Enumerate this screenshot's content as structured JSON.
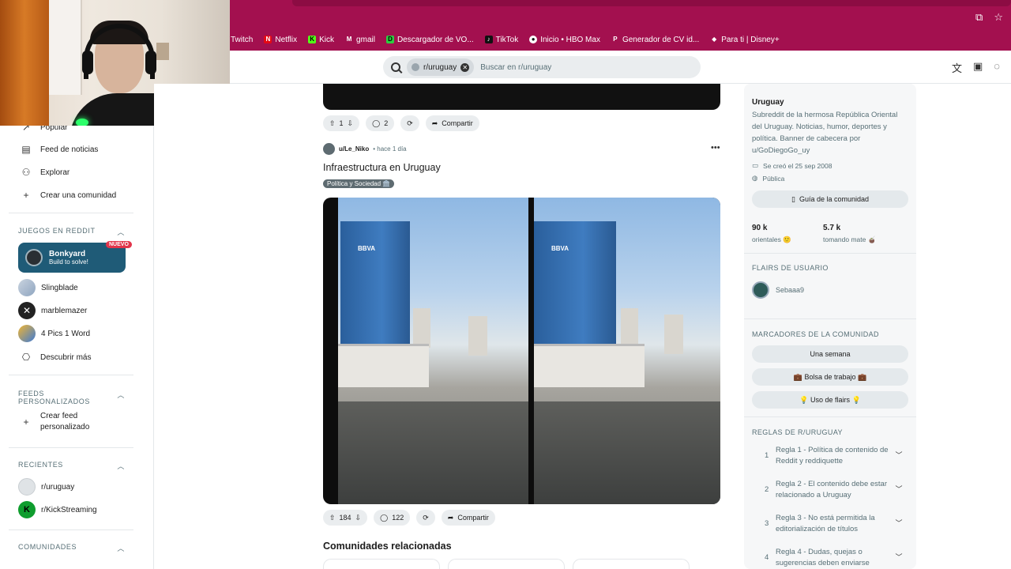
{
  "browser": {
    "bookmarks": [
      {
        "label": "Twitch",
        "icon": "twitch-icon",
        "color": "#a970ff"
      },
      {
        "label": "Netflix",
        "icon": "netflix-icon",
        "color": "#e50914"
      },
      {
        "label": "Kick",
        "icon": "kick-icon",
        "color": "#53fc18"
      },
      {
        "label": "gmail",
        "icon": "gmail-icon",
        "color": "#ea4335"
      },
      {
        "label": "Descargador de VO...",
        "icon": "downloader-icon",
        "color": "#2ecc40"
      },
      {
        "label": "TikTok",
        "icon": "tiktok-icon",
        "color": "#111111"
      },
      {
        "label": "Inicio • HBO Max",
        "icon": "hbo-icon",
        "color": "#111111"
      },
      {
        "label": "Generador de CV id...",
        "icon": "cv-icon",
        "color": "#ffffff"
      },
      {
        "label": "Para ti | Disney+",
        "icon": "disney-icon",
        "color": "#113ccf"
      }
    ]
  },
  "header": {
    "search_chip": "r/uruguay",
    "search_placeholder": "Buscar en r/uruguay"
  },
  "sidebar": {
    "items": [
      {
        "label": "Popular",
        "icon": "trending-icon"
      },
      {
        "label": "Feed de noticias",
        "icon": "news-icon"
      },
      {
        "label": "Explorar",
        "icon": "explore-icon"
      },
      {
        "label": "Crear una comunidad",
        "icon": "plus-icon"
      }
    ],
    "games_heading": "JUEGOS EN REDDIT",
    "featured_game": {
      "name": "Bonkyard",
      "subtitle": "Build to solve!",
      "badge": "NUEVO"
    },
    "games": [
      "Slingblade",
      "marblemazer",
      "4 Pics 1 Word",
      "Descubrir más"
    ],
    "custom_feeds_heading": "FEEDS PERSONALIZADOS",
    "create_feed_line1": "Crear feed",
    "create_feed_line2": "personalizado",
    "recents_heading": "RECIENTES",
    "recents": [
      "r/uruguay",
      "r/KickStreaming"
    ],
    "communities_heading": "COMUNIDADES"
  },
  "feed": {
    "prev_post": {
      "votes": "1",
      "comments": "2",
      "share": "Compartir"
    },
    "post": {
      "author": "u/Le_Niko",
      "time": "• hace 1 día",
      "title": "Infraestructura en Uruguay",
      "flair": "Política y Sociedad 🏛️",
      "votes": "184",
      "comments": "122",
      "share": "Compartir",
      "image_label": "BBVA"
    },
    "related_title": "Comunidades relacionadas"
  },
  "community": {
    "name": "Uruguay",
    "description": "Subreddit de la hermosa República Oriental del Uruguay. Noticias, humor, deportes y política. Banner de cabecera por u/GoDiegoGo_uy",
    "created": "Se creó el 25 sep 2008",
    "visibility": "Pública",
    "guide_button": "Guía de la comunidad",
    "members_count": "90 k",
    "members_label": "orientales 🙂",
    "online_count": "5.7 k",
    "online_label": "tomando mate 🧉",
    "user_flairs_heading": "FLAIRS DE USUARIO",
    "user_flair": "Sebaaa9",
    "bookmarks_heading": "MARCADORES DE LA COMUNIDAD",
    "bookmarks": [
      "Una semana",
      "💼 Bolsa de trabajo 💼",
      "💡 Uso de flairs 💡"
    ],
    "rules_heading": "REGLAS DE R/URUGUAY",
    "rules": [
      {
        "num": "1",
        "text": "Regla 1 - Política de contenido de Reddit y reddiquette"
      },
      {
        "num": "2",
        "text": "Regla 2 - El contenido debe estar relacionado a Uruguay"
      },
      {
        "num": "3",
        "text": "Regla 3 - No está permitida la editorialización de títulos"
      },
      {
        "num": "4",
        "text": "Regla 4 - Dudas, quejas o sugerencias deben enviarse"
      }
    ]
  }
}
